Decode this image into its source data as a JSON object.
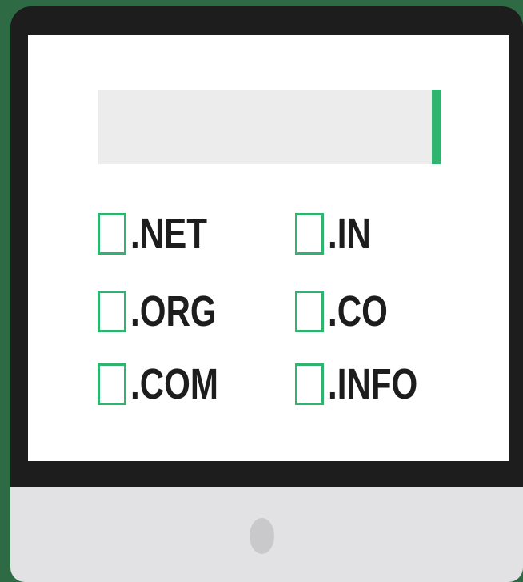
{
  "colors": {
    "background": "#2e6b45",
    "bezel": "#1d1d1d",
    "screen": "#ffffff",
    "chin": "#e2e2e4",
    "power_dot": "#c9c9cb",
    "search_field": "#ececec",
    "accent": "#2eb46e",
    "text": "#1d1d1d"
  },
  "search": {
    "value": "",
    "placeholder": ""
  },
  "domains": [
    {
      "label": ".NET",
      "checked": false
    },
    {
      "label": ".IN",
      "checked": false
    },
    {
      "label": ".ORG",
      "checked": false
    },
    {
      "label": ".CO",
      "checked": false
    },
    {
      "label": ".COM",
      "checked": false
    },
    {
      "label": ".INFO",
      "checked": false
    }
  ]
}
